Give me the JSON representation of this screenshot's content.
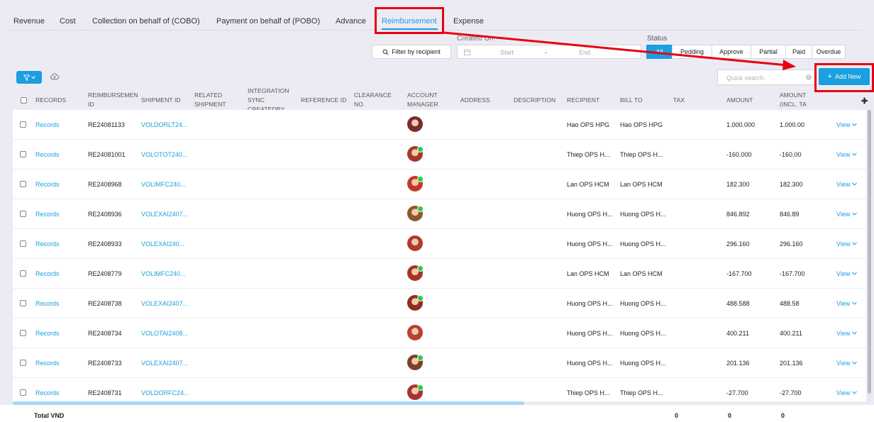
{
  "tabs": [
    {
      "label": "Revenue"
    },
    {
      "label": "Cost"
    },
    {
      "label": "Collection on behalf of (COBO)"
    },
    {
      "label": "Payment on behalf of (POBO)"
    },
    {
      "label": "Advance"
    },
    {
      "label": "Reimbursement"
    },
    {
      "label": "Expense"
    }
  ],
  "active_tab": "Reimbursement",
  "filters": {
    "filter_recipient_label": "Filter by recipient",
    "created_on_label": "Created On",
    "date_start_placeholder": "Start",
    "date_separator": "-",
    "date_end_placeholder": "End",
    "status_label": "Status",
    "status_options": [
      "All",
      "Pedding",
      "Approve",
      "Partial",
      "Paid",
      "Overdue"
    ],
    "status_selected": "All"
  },
  "toolbar": {
    "quick_search_placeholder": "Quick search",
    "add_new_label": "Add New"
  },
  "table": {
    "headers": {
      "records": "RECORDS",
      "reimbursement_id": "REIMBURSEMEN ID",
      "shipment_id": "SHIPMENT ID",
      "related_shipment": "RELATED SHIPMENT",
      "integration_sync": "INTEGRATION SYNC CREATEDBY",
      "reference_id": "REFERENCE ID",
      "clearance_no": "CLEARANCE NO.",
      "account_manager": "ACCOUNT MANAGER",
      "address": "ADDRESS",
      "description": "DESCRIPTION",
      "recipient": "RECIPIENT",
      "bill_to": "BILL TO",
      "tax": "TAX",
      "amount": "AMOUNT",
      "amount_incl_tax": "AMOUNT (INCL. TA"
    },
    "rows": [
      {
        "records": "Records",
        "id": "RE24081133",
        "shipment": "VOLDORLT24...",
        "recipient": "Hao OPS HPG",
        "bill_to": "Hao OPS HPG",
        "amount": "1.000.000",
        "amount_incl": "1.000.00",
        "action": "View",
        "online": false
      },
      {
        "records": "Records",
        "id": "RE24081001",
        "shipment": "VOLOTOT240...",
        "recipient": "Thiep OPS H...",
        "bill_to": "Thiep OPS H...",
        "amount": "-160.000",
        "amount_incl": "-160.00",
        "action": "View",
        "online": true
      },
      {
        "records": "Records",
        "id": "RE2408968",
        "shipment": "VOLIMFC240...",
        "recipient": "Lan OPS HCM",
        "bill_to": "Lan OPS HCM",
        "amount": "182.300",
        "amount_incl": "182.300",
        "action": "View",
        "online": true
      },
      {
        "records": "Records",
        "id": "RE2408936",
        "shipment": "VOLEXAI2407...",
        "recipient": "Huong OPS H...",
        "bill_to": "Huong OPS H...",
        "amount": "846.892",
        "amount_incl": "846.89",
        "action": "View",
        "online": true
      },
      {
        "records": "Records",
        "id": "RE2408933",
        "shipment": "VOLEXAI240...",
        "recipient": "Huong OPS H...",
        "bill_to": "Huong OPS H...",
        "amount": "296.160",
        "amount_incl": "296.160",
        "action": "View",
        "online": false
      },
      {
        "records": "Records",
        "id": "RE2408779",
        "shipment": "VOLIMFC240...",
        "recipient": "Lan OPS HCM",
        "bill_to": "Lan OPS HCM",
        "amount": "-167.700",
        "amount_incl": "-167.700",
        "action": "View",
        "online": true
      },
      {
        "records": "Records",
        "id": "RE2408738",
        "shipment": "VOLEXAI2407...",
        "recipient": "Huong OPS H...",
        "bill_to": "Huong OPS H...",
        "amount": "488.588",
        "amount_incl": "488.58",
        "action": "View",
        "online": true
      },
      {
        "records": "Records",
        "id": "RE2408734",
        "shipment": "VOLOTAI2408...",
        "recipient": "Huong OPS H...",
        "bill_to": "Huong OPS H...",
        "amount": "400.211",
        "amount_incl": "400.211",
        "action": "View",
        "online": false
      },
      {
        "records": "Records",
        "id": "RE2408733",
        "shipment": "VOLEXAI2407...",
        "recipient": "Huong OPS H...",
        "bill_to": "Huong OPS H...",
        "amount": "201.136",
        "amount_incl": "201.136",
        "action": "View",
        "online": true
      },
      {
        "records": "Records",
        "id": "RE2408731",
        "shipment": "VOLDORFC24...",
        "recipient": "Thiep OPS H...",
        "bill_to": "Thiep OPS H...",
        "amount": "-27.700",
        "amount_incl": "-27.700",
        "action": "View",
        "online": true
      }
    ],
    "total": {
      "label": "Total VND",
      "tax": "0",
      "amount": "0",
      "amount_incl": "0"
    }
  },
  "colors": {
    "accent": "#1a9fe0",
    "highlight": "#e8000f",
    "online": "#2ecc40"
  }
}
